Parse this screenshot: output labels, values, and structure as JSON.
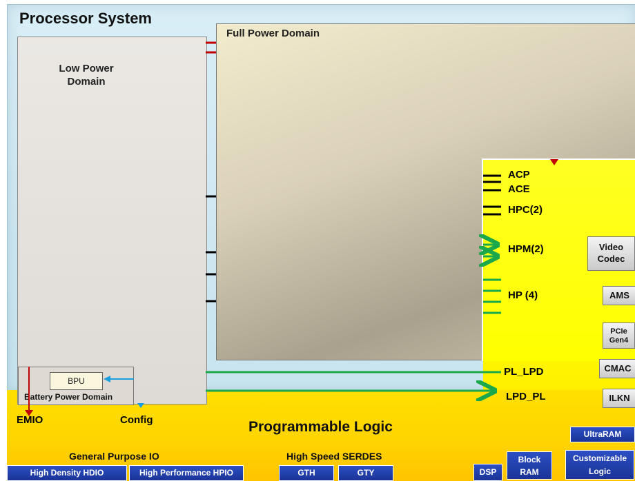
{
  "processor_system": {
    "title": "Processor System"
  },
  "low_power_domain": {
    "title": "Low Power\nDomain"
  },
  "full_power_domain": {
    "title": "Full Power Domain"
  },
  "battery_power_domain": {
    "label": "Battery Power Domain",
    "bpu": "BPU"
  },
  "ports": {
    "acp": "ACP",
    "ace": "ACE",
    "hpc": "HPC(2)",
    "hpm": "HPM(2)",
    "hp": "HP (4)",
    "pl_lpd": "PL_LPD",
    "lpd_pl": "LPD_PL"
  },
  "pl_blocks": {
    "video_codec": "Video\nCodec",
    "ams": "AMS",
    "pcie": "PCIe\nGen4",
    "cmac": "CMAC",
    "ilkn": "ILKN"
  },
  "bottom": {
    "emio": "EMIO",
    "config": "Config",
    "programmable_logic": "Programmable Logic",
    "general_purpose_io": "General Purpose IO",
    "hdio": "High Density HDIO",
    "hpio": "High Performance HPIO",
    "serdes": "High Speed SERDES",
    "gth": "GTH",
    "gty": "GTY",
    "dsp": "DSP",
    "block_ram": "Block\nRAM",
    "ultraram": "UltraRAM",
    "customizable_logic": "Customizable\nLogic"
  },
  "colors": {
    "red": "#c00000",
    "green": "#1aa84a",
    "blue": "#1a9ee0",
    "black": "#000000"
  }
}
